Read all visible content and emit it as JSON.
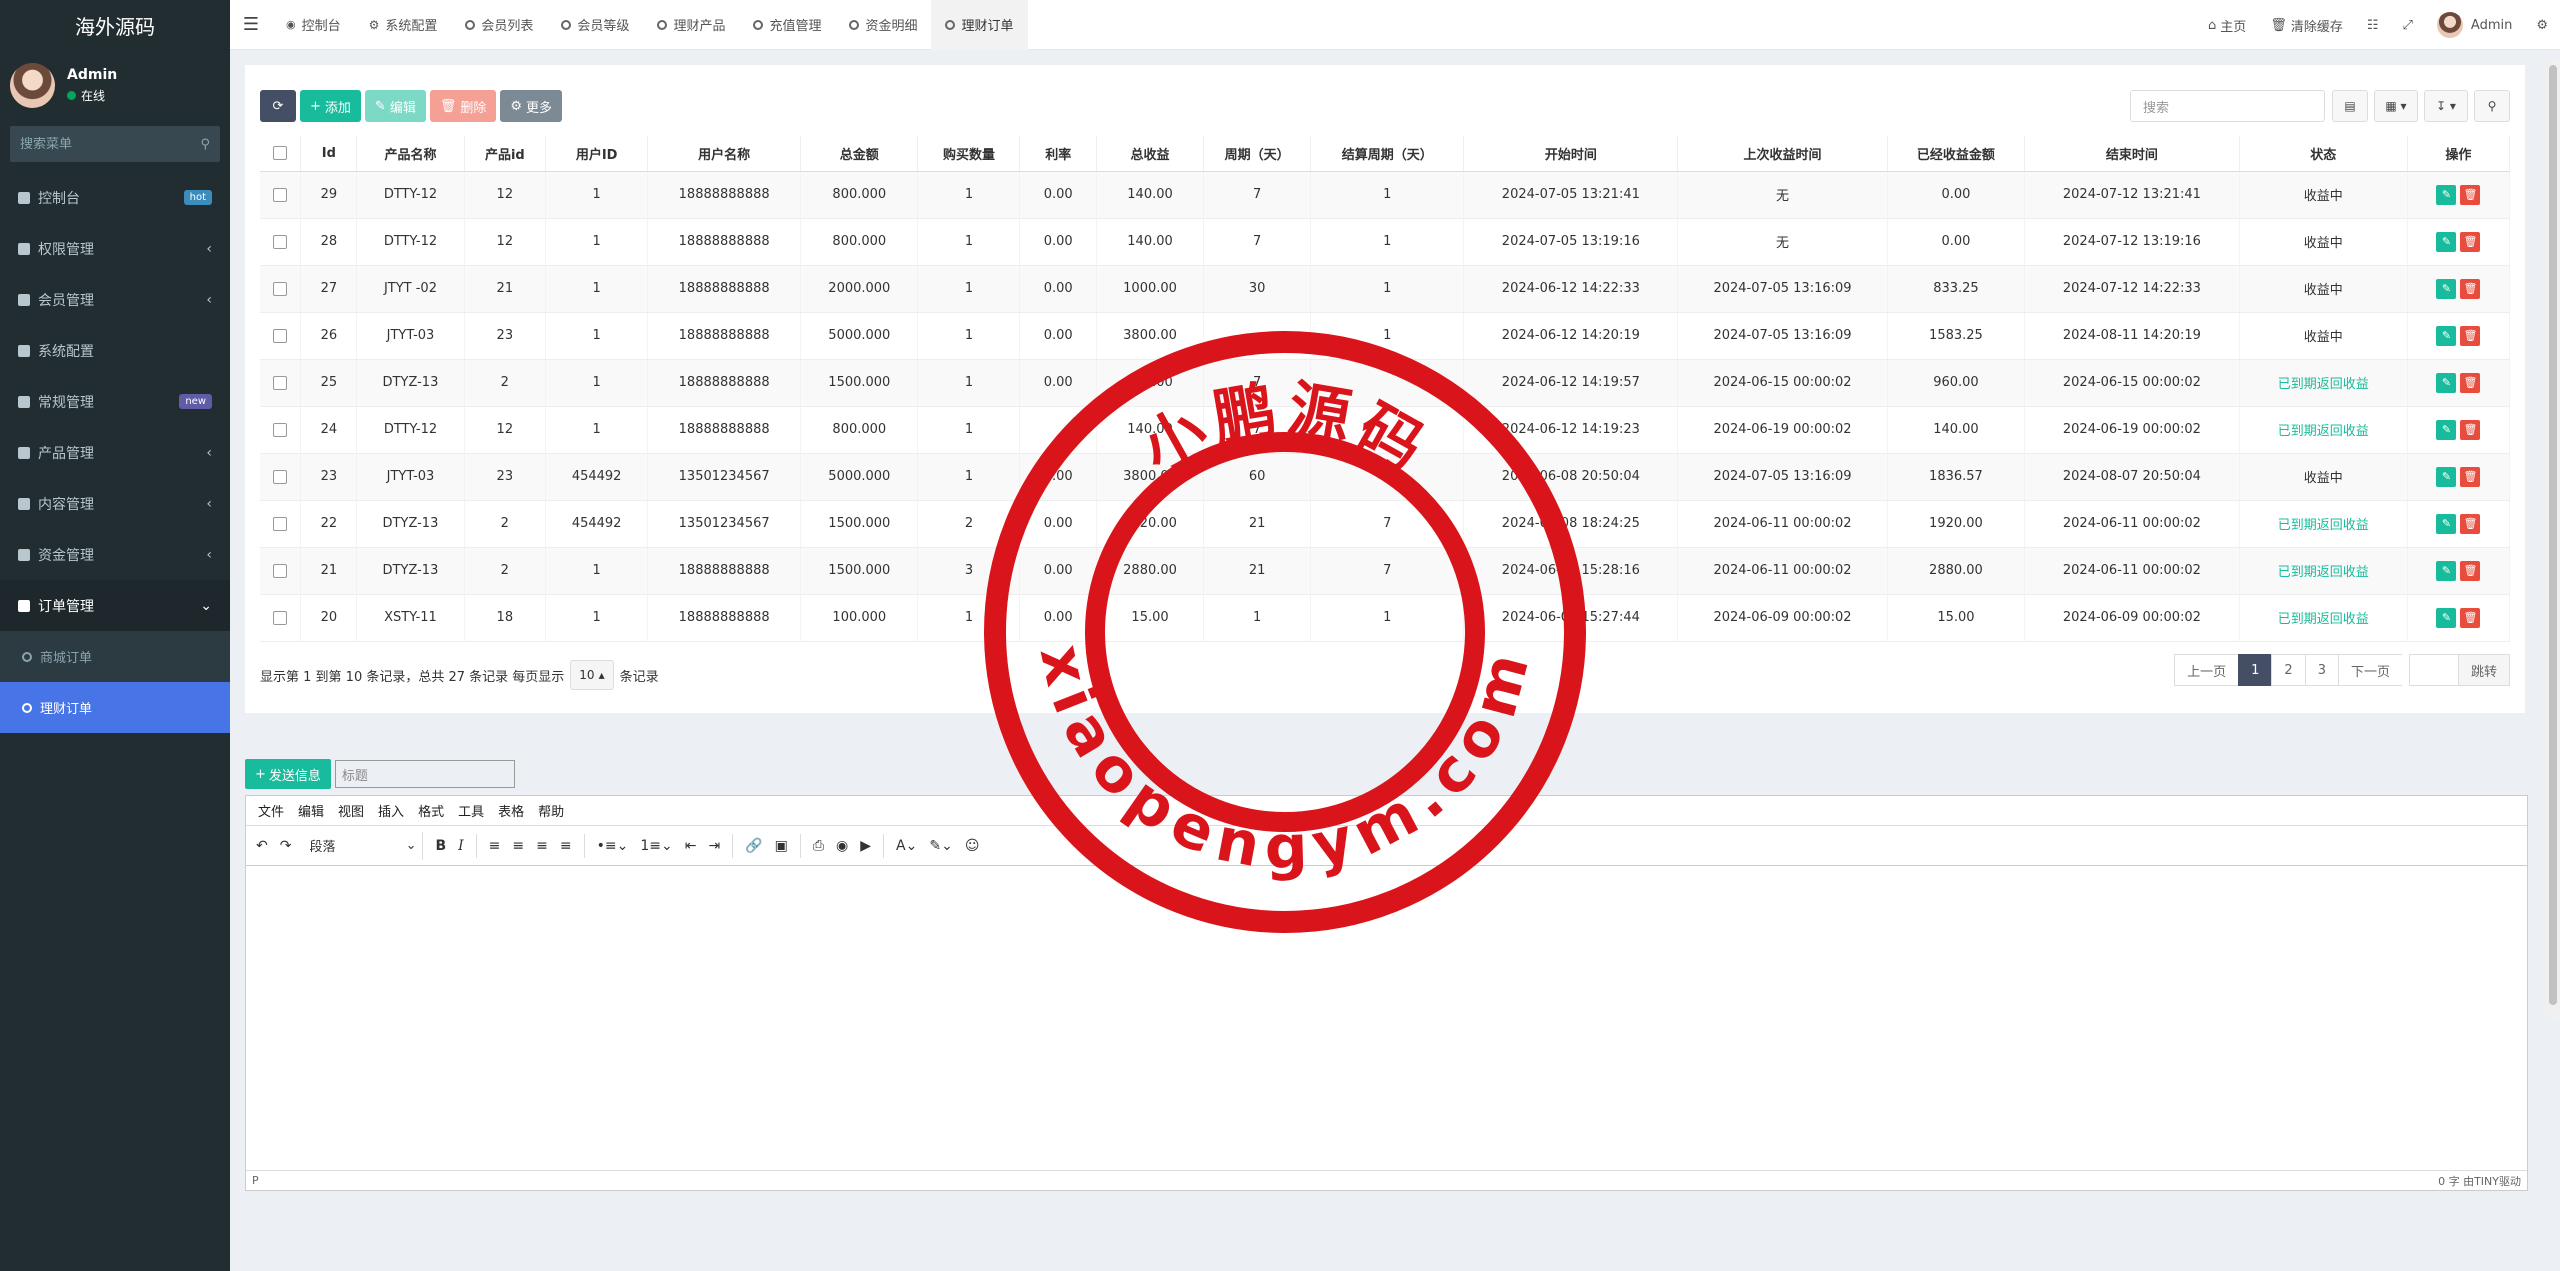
{
  "app": {
    "title": "海外源码"
  },
  "user": {
    "name": "Admin",
    "status": "在线"
  },
  "sidebar": {
    "search_placeholder": "搜索菜单",
    "items": [
      {
        "label": "控制台",
        "badge": "hot"
      },
      {
        "label": "权限管理"
      },
      {
        "label": "会员管理"
      },
      {
        "label": "系统配置"
      },
      {
        "label": "常规管理",
        "badge": "new"
      },
      {
        "label": "产品管理"
      },
      {
        "label": "内容管理"
      },
      {
        "label": "资金管理"
      },
      {
        "label": "订单管理"
      }
    ],
    "subitems": [
      {
        "label": "商城订单"
      },
      {
        "label": "理财订单"
      }
    ]
  },
  "topbar": {
    "tabs": [
      "控制台",
      "系统配置",
      "会员列表",
      "会员等级",
      "理财产品",
      "充值管理",
      "资金明细",
      "理财订单"
    ],
    "home": "主页",
    "clear_cache": "清除缓存",
    "admin": "Admin"
  },
  "toolbar": {
    "add": "添加",
    "edit": "编辑",
    "delete": "删除",
    "more": "更多",
    "search_placeholder": "搜索"
  },
  "table": {
    "headers": [
      "Id",
      "产品名称",
      "产品id",
      "用户ID",
      "用户名称",
      "总金额",
      "购买数量",
      "利率",
      "总收益",
      "周期（天）",
      "结算周期（天）",
      "开始时间",
      "上次收益时间",
      "已经收益金额",
      "结束时间",
      "状态",
      "操作"
    ],
    "rows": [
      [
        "29",
        "DTTY-12",
        "12",
        "1",
        "18888888888",
        "800.000",
        "1",
        "0.00",
        "140.00",
        "7",
        "1",
        "2024-07-05 13:21:41",
        "无",
        "0.00",
        "2024-07-12 13:21:41",
        "收益中"
      ],
      [
        "28",
        "DTTY-12",
        "12",
        "1",
        "18888888888",
        "800.000",
        "1",
        "0.00",
        "140.00",
        "7",
        "1",
        "2024-07-05 13:19:16",
        "无",
        "0.00",
        "2024-07-12 13:19:16",
        "收益中"
      ],
      [
        "27",
        "JTYT -02",
        "21",
        "1",
        "18888888888",
        "2000.000",
        "1",
        "0.00",
        "1000.00",
        "30",
        "1",
        "2024-06-12 14:22:33",
        "2024-07-05 13:16:09",
        "833.25",
        "2024-07-12 14:22:33",
        "收益中"
      ],
      [
        "26",
        "JTYT-03",
        "23",
        "1",
        "18888888888",
        "5000.000",
        "1",
        "0.00",
        "3800.00",
        "",
        "1",
        "2024-06-12 14:20:19",
        "2024-07-05 13:16:09",
        "1583.25",
        "2024-08-11 14:20:19",
        "收益中"
      ],
      [
        "25",
        "DTYZ-13",
        "2",
        "1",
        "18888888888",
        "1500.000",
        "1",
        "0.00",
        "960.00",
        "7",
        "",
        "2024-06-12 14:19:57",
        "2024-06-15 00:00:02",
        "960.00",
        "2024-06-15 00:00:02",
        "已到期返回收益"
      ],
      [
        "24",
        "DTTY-12",
        "12",
        "1",
        "18888888888",
        "800.000",
        "1",
        "",
        "140.00",
        "7",
        "",
        "2024-06-12 14:19:23",
        "2024-06-19 00:00:02",
        "140.00",
        "2024-06-19 00:00:02",
        "已到期返回收益"
      ],
      [
        "23",
        "JTYT-03",
        "23",
        "454492",
        "13501234567",
        "5000.000",
        "1",
        "0.00",
        "3800.00",
        "60",
        "",
        "2024-06-08 20:50:04",
        "2024-07-05 13:16:09",
        "1836.57",
        "2024-08-07 20:50:04",
        "收益中"
      ],
      [
        "22",
        "DTYZ-13",
        "2",
        "454492",
        "13501234567",
        "1500.000",
        "2",
        "0.00",
        "1920.00",
        "21",
        "7",
        "2024-06-08 18:24:25",
        "2024-06-11 00:00:02",
        "1920.00",
        "2024-06-11 00:00:02",
        "已到期返回收益"
      ],
      [
        "21",
        "DTYZ-13",
        "2",
        "1",
        "18888888888",
        "1500.000",
        "3",
        "0.00",
        "2880.00",
        "21",
        "7",
        "2024-06-08 15:28:16",
        "2024-06-11 00:00:02",
        "2880.00",
        "2024-06-11 00:00:02",
        "已到期返回收益"
      ],
      [
        "20",
        "XSTY-11",
        "18",
        "1",
        "18888888888",
        "100.000",
        "1",
        "0.00",
        "15.00",
        "1",
        "1",
        "2024-06-08 15:27:44",
        "2024-06-09 00:00:02",
        "15.00",
        "2024-06-09 00:00:02",
        "已到期返回收益"
      ]
    ]
  },
  "pagination": {
    "info_prefix": "显示第 1 到第 10 条记录，总共 27 条记录 每页显示",
    "page_size": "10",
    "info_suffix": "条记录",
    "prev": "上一页",
    "pages": [
      "1",
      "2",
      "3"
    ],
    "next": "下一页",
    "jump": "跳转"
  },
  "compose": {
    "send": "发送信息",
    "title_placeholder": "标题",
    "menubar": [
      "文件",
      "编辑",
      "视图",
      "插入",
      "格式",
      "工具",
      "表格",
      "帮助"
    ],
    "format": "段落",
    "status_left": "P",
    "status_right": "0 字 由TINY驱动"
  },
  "watermark": {
    "top": "小鹏源码",
    "bottom": "xiaopengym.com",
    "color": "#d9141a"
  }
}
